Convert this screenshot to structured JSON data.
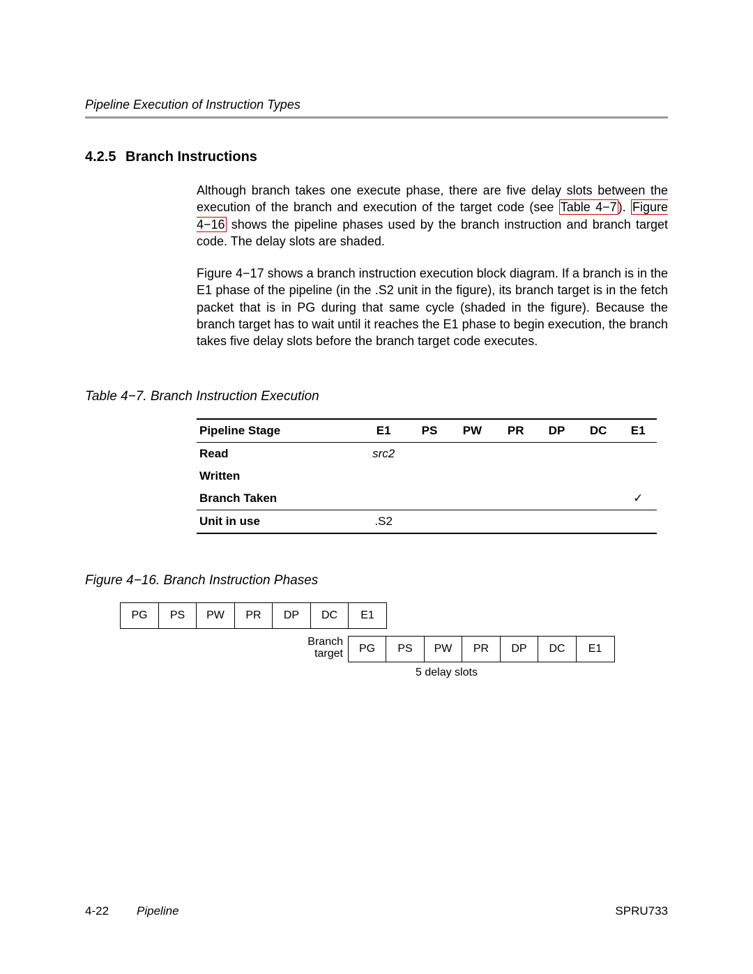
{
  "runningHead": "Pipeline Execution of Instruction Types",
  "section": {
    "number": "4.2.5",
    "title": "Branch Instructions"
  },
  "para1": {
    "t1": "Although branch takes one execute phase, there are five delay slots between the execution of the branch and execution of the target code (see ",
    "ref1": "Table 4−7",
    "t2": "). ",
    "ref2": "Figure 4−16",
    "t3": " shows the pipeline phases used by the branch instruction and branch target code. The delay slots are shaded."
  },
  "para2": "Figure 4−17 shows a branch instruction execution block diagram. If a branch is in the E1 phase of the pipeline (in the .S2 unit in the figure), its branch target is in the fetch packet that is in PG during that same cycle (shaded in the figure). Because the branch target has to wait until it reaches the E1 phase to begin execution, the branch takes five delay slots before the branch target code executes.",
  "tableCaption": "Table 4−7. Branch Instruction Execution",
  "table": {
    "headers": [
      "Pipeline Stage",
      "E1",
      "PS",
      "PW",
      "PR",
      "DP",
      "DC",
      "E1"
    ],
    "rows": [
      {
        "label": "Read",
        "c": [
          "src2",
          "",
          "",
          "",
          "",
          "",
          ""
        ]
      },
      {
        "label": "Written",
        "c": [
          "",
          "",
          "",
          "",
          "",
          "",
          ""
        ]
      },
      {
        "label": "Branch Taken",
        "c": [
          "",
          "",
          "",
          "",
          "",
          "",
          "✓"
        ]
      },
      {
        "label": "Unit in use",
        "c": [
          ".S2",
          "",
          "",
          "",
          "",
          "",
          ""
        ]
      }
    ]
  },
  "figureCaption": "Figure 4−16. Branch Instruction Phases",
  "figure": {
    "rowTop": [
      "PG",
      "PS",
      "PW",
      "PR",
      "DP",
      "DC",
      "E1"
    ],
    "rowBottomLabel": "Branch\ntarget",
    "rowBottom": [
      "PG",
      "PS",
      "PW",
      "PR",
      "DP",
      "DC",
      "E1"
    ],
    "delay": "5 delay slots"
  },
  "footer": {
    "pagenum": "4-22",
    "chapter": "Pipeline",
    "docnum": "SPRU733"
  }
}
